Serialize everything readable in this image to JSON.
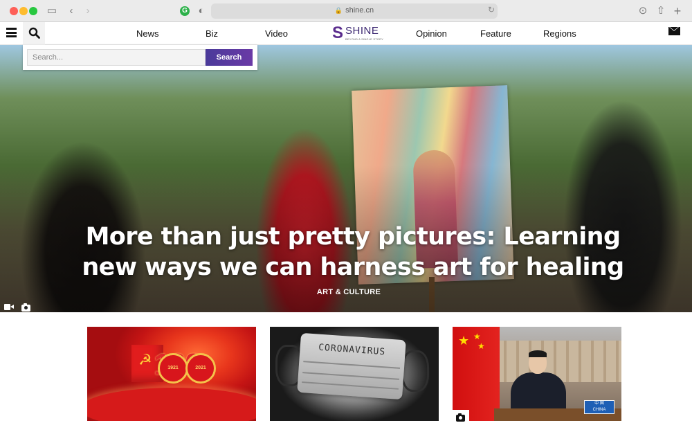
{
  "browser": {
    "url": "shine.cn",
    "icons": [
      "sidebar-icon",
      "back-icon",
      "forward-icon",
      "extension-icon",
      "shield-icon",
      "lock-icon",
      "reload-icon",
      "download-icon",
      "share-icon",
      "new-tab-icon"
    ]
  },
  "nav": {
    "items": [
      "News",
      "Biz",
      "Video",
      "Opinion",
      "Feature",
      "Regions"
    ],
    "logo_text": "SHINE",
    "logo_tagline": "BEYOND A SINGLE STORY"
  },
  "search": {
    "placeholder": "Search...",
    "button_label": "Search"
  },
  "hero": {
    "title": "More than just pretty pictures: Learning new ways we can harness art for healing",
    "category": "ART & CULTURE"
  },
  "cards": [
    {
      "image_text": [
        "1921",
        "2021"
      ],
      "number": "100"
    },
    {
      "image_text": "CORONAVIRUS"
    },
    {
      "nameplate": [
        "中 国",
        "CHINA"
      ]
    }
  ],
  "colors": {
    "accent": "#5b2d8e",
    "search_button": "#5a3aa0"
  }
}
